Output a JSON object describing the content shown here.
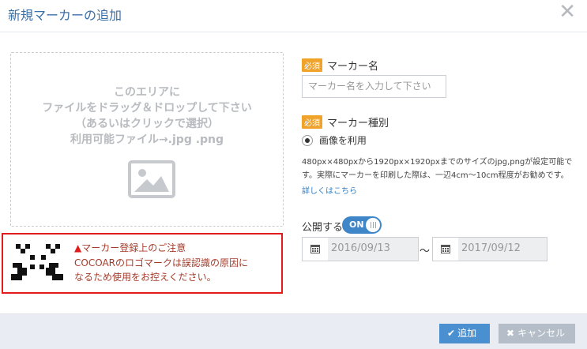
{
  "dialog": {
    "title": "新規マーカーの追加"
  },
  "dropzone": {
    "lines": [
      "このエリアに",
      "ファイルをドラッグ＆ドロップして下さい",
      "（あるいはクリックで選択）",
      "利用可能ファイル→.jpg .png"
    ]
  },
  "warning": {
    "title": "マーカー登録上のご注意",
    "lines": [
      "COCOARのロゴマークは誤認識の原因に",
      "なるため使用をお控えください。"
    ]
  },
  "form": {
    "required_badge": "必須",
    "marker_name_label": "マーカー名",
    "marker_name_placeholder": "マーカー名を入力して下さい",
    "marker_type_label": "マーカー種別",
    "marker_type_option": "画像を利用",
    "description_lines": [
      "480px×480pxから1920px×1920pxまでのサイズのjpg,pngが設定可能で",
      "す。実際にマーカーを印刷した際は、一辺4cm～10cm程度がお勧めです。"
    ],
    "details_link": "詳しくはこちら",
    "publish_label": "公開する",
    "toggle_label": "ON",
    "start_date": "2016/09/13",
    "end_date": "2017/09/12",
    "date_separator": "～"
  },
  "footer": {
    "add_label": "追加",
    "cancel_label": "キャンセル"
  }
}
